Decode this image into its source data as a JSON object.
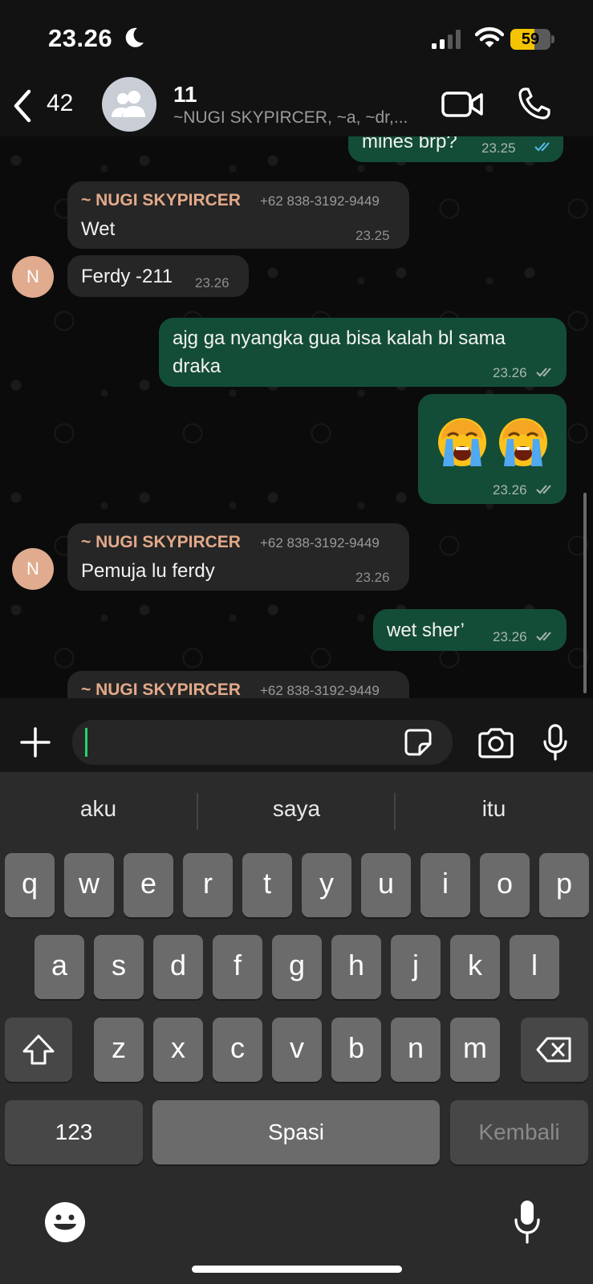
{
  "status_bar": {
    "time": "23.26",
    "battery": "59",
    "battery_level": 0.59
  },
  "header": {
    "back_count": "42",
    "title": "11",
    "subtitle": "~NUGI SKYPIRCER, ~a, ~dr,...",
    "icons": [
      "chevron-left-icon",
      "group-icon",
      "video-icon",
      "phone-icon"
    ]
  },
  "messages": [
    {
      "type": "outgoing",
      "text": "mines brp?",
      "time": "23.25",
      "status": "read"
    },
    {
      "type": "incoming",
      "sender": "~ NUGI SKYPIRCER",
      "phone": "+62 838-3192-9449",
      "text": "Wet",
      "time": "23.25"
    },
    {
      "type": "incoming",
      "avatar": "N",
      "text": "Ferdy -211",
      "time": "23.26"
    },
    {
      "type": "outgoing",
      "text_line1": "ajg ga nyangka gua bisa kalah bl sama",
      "text_line2": "draka",
      "time": "23.26",
      "status": "delivered"
    },
    {
      "type": "outgoing",
      "emoji": "loudly-crying-face x2",
      "time": "23.26",
      "status": "delivered"
    },
    {
      "type": "incoming",
      "avatar": "N",
      "sender": "~ NUGI SKYPIRCER",
      "phone": "+62 838-3192-9449",
      "text": "Pemuja lu ferdy",
      "time": "23.26"
    },
    {
      "type": "outgoing",
      "text": "wet sher’",
      "time": "23.26",
      "status": "delivered"
    },
    {
      "type": "incoming",
      "sender": "~ NUGI SKYPIRCER",
      "phone": "+62 838-3192-9449"
    }
  ],
  "input": {
    "value": "",
    "icons": [
      "plus-icon",
      "sticker-icon",
      "camera-icon",
      "microphone-icon"
    ]
  },
  "keyboard": {
    "suggestions": [
      "aku",
      "saya",
      "itu"
    ],
    "row1": [
      "q",
      "w",
      "e",
      "r",
      "t",
      "y",
      "u",
      "i",
      "o",
      "p"
    ],
    "row2": [
      "a",
      "s",
      "d",
      "f",
      "g",
      "h",
      "j",
      "k",
      "l"
    ],
    "row3": [
      "z",
      "x",
      "c",
      "v",
      "b",
      "n",
      "m"
    ],
    "numbers_key": "123",
    "space_key": "Spasi",
    "return_key": "Kembali"
  },
  "colors": {
    "outgoing_bubble": "#144d37",
    "incoming_bubble": "#262626",
    "sender_name": "#e3a989",
    "accent": "#25d366"
  }
}
